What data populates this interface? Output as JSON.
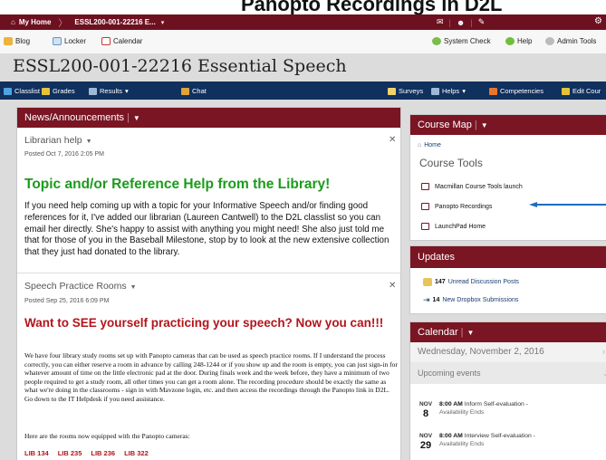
{
  "page_heading": "Panopto Recordings in D2L",
  "topnav": {
    "home": "My Home",
    "course": "ESSL200-001-22216 E...",
    "caret": "▾"
  },
  "links": {
    "blog": "Blog",
    "locker": "Locker",
    "calendar": "Calendar",
    "system_check": "System Check",
    "help": "Help",
    "admin_tools": "Admin Tools"
  },
  "course_title": "ESSL200-001-22216 Essential Speech",
  "coursenav": {
    "classlist": "Classlist",
    "grades": "Grades",
    "results": "Results",
    "chat": "Chat",
    "surveys": "Surveys",
    "helps": "Helps",
    "competencies": "Competencies",
    "edit_course": "Edit Cour"
  },
  "news": {
    "header": "News/Announcements",
    "item1": {
      "title": "Librarian help",
      "posted": "Posted Oct 7, 2016 2:05 PM",
      "heading": "Topic and/or Reference Help from the Library!",
      "body": "If you need help coming up with a topic for your Informative Speech and/or finding good references for it, I've added our librarian (Laureen Cantwell) to the D2L classlist so you can email her directly.  She's happy to assist with anything you might need!  She also just told me that for those of you in the Baseball Milestone, stop by to look at the new extensive collection that they just had donated to the library."
    },
    "item2": {
      "title": "Speech Practice Rooms",
      "posted": "Posted Sep 25, 2016 6:09 PM",
      "heading": "Want to SEE yourself practicing your speech?  Now you can!!!",
      "body": "We have four library study rooms set up with Panopto cameras that can be used as speech practice rooms.  If I understand the process correctly, you can either reserve a room in advance by calling 248-1244 or if you show up and the room is empty, you can just sign-in for whatever amount of time on the little electronic pad at the door.  During finals week and the week before, they have a minimum of two people required to get a study room, all other times you can get a room alone.  The recording procedure should be exactly the same as what we're doing in the classrooms - sign in with Mavzone login, etc. and then access the recordings through the Panopto link in D2L.  Go down to the IT Helpdesk if you need assistance.",
      "rooms_intro": "Here are the rooms now equipped with the Panopto cameras:",
      "rooms": [
        "LIB 134",
        "LIB 235",
        "LIB 236",
        "LIB 322"
      ]
    }
  },
  "coursemap": {
    "header": "Course Map",
    "home": "Home",
    "tools_heading": "Course Tools",
    "links": [
      "Macmillan Course Tools launch",
      "Panopto Recordings",
      "LaunchPad Home"
    ]
  },
  "updates": {
    "header": "Updates",
    "discussion_count": "147",
    "discussion_label": "Unread Discussion Posts",
    "dropbox_count": "14",
    "dropbox_label": "New Dropbox Submissions"
  },
  "calendar": {
    "header": "Calendar",
    "date": "Wednesday, November 2, 2016",
    "upcoming": "Upcoming events",
    "events": [
      {
        "month": "NOV",
        "day": "8",
        "time": "8:00 AM",
        "title": "Inform Self-evaluation -",
        "sub": "Availability Ends"
      },
      {
        "month": "NOV",
        "day": "29",
        "time": "8:00 AM",
        "title": "Interview Self-evaluation -",
        "sub": "Availability Ends"
      }
    ]
  },
  "colors": {
    "maroon": "#7a1523",
    "navy": "#10305e",
    "green_heading": "#1c9b1c",
    "red_heading": "#b3141b",
    "arrow": "#1f6cc0"
  }
}
